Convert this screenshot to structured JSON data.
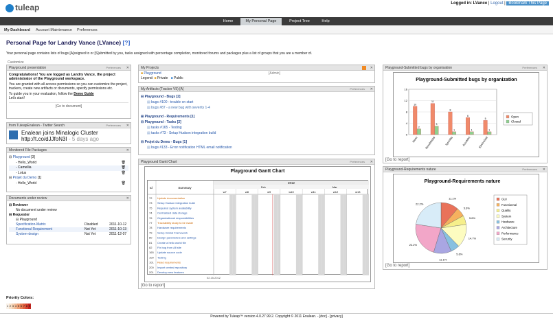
{
  "app": {
    "logo_text": "tuleap"
  },
  "user": {
    "logged_in": "Logged in: LVance",
    "logout": "Logout",
    "bookmark": "Bookmark This Page"
  },
  "nav": [
    {
      "label": "Home"
    },
    {
      "label": "My Personal Page"
    },
    {
      "label": "Project Tree"
    },
    {
      "label": "Help"
    }
  ],
  "subnav": [
    {
      "label": "My Dashboard"
    },
    {
      "label": "Account Maintenance"
    },
    {
      "label": "Preferences"
    }
  ],
  "page": {
    "title": "Personal Page for Landry Vance (LVance)",
    "help": "[?]",
    "intro": "Your personal page contains lists of bugs [A]ssigned to or [S]ubmitted by you, tasks assigned with percentage completion, monitored forums and packages plus a list of groups that you are a member of.",
    "customize": "Customize"
  },
  "w_presentation": {
    "title": "Playground presentation",
    "p1": "Congratulations! You are logged as Landry Vance, the project administrator of the Playground workspace.",
    "p2": "You are granted with all access permissions so you can customize the project, trackers, create new artifacts or documents, specify permissions etc.",
    "p3a": "To guide you in your evaluation, follow the",
    "p3b": "Demo Guide",
    "p4": "Let's start!",
    "go": "[Go to document]"
  },
  "w_twitter": {
    "title": "from TuleapEnalean - Twitter Search",
    "tweet": "Enalean joins Minalogic Cluster",
    "link": "http://t.co/dJJfoN3I",
    "time": "- 5 days ago"
  },
  "w_packages": {
    "title": "Monitored File Packages",
    "g1": "Playground",
    "g1n": "[3]",
    "items1": [
      "- Hello_World",
      "- Camellia",
      "- Lotus"
    ],
    "g2": "Projet du Demo",
    "g2n": "[1]",
    "items2": [
      "- Hello_World"
    ]
  },
  "w_docs": {
    "title": "Documents under review",
    "reviewer": "Reviewer",
    "no_doc": "No document under review",
    "requester": "Requester",
    "group": "Playground",
    "rows": [
      {
        "name": "Specification-Matrix",
        "status": "Disabled",
        "date": "2011-10-12"
      },
      {
        "name": "Functional Requirement",
        "status": "Not Yet",
        "date": "2011-10-13"
      },
      {
        "name": "System-design",
        "status": "Not Yet",
        "date": "2011-12-07"
      }
    ]
  },
  "w_projects": {
    "title": "My Projects",
    "project": "Playground",
    "role": "[Admin]",
    "legend": "Legend:",
    "private": "Private",
    "public": "Public"
  },
  "w_artifacts": {
    "title": "My Artifacts (Tracker V5) [A]",
    "g1": "Playground - Bugs [2]",
    "g1items": [
      "bugs #100 - trouble on start",
      "bugs #87 - a new bug with severity 1-4"
    ],
    "g2": "Playground - Requirements [1]",
    "g3": "Playground - Tasks [2]",
    "g3items": [
      "tasks #165 - Testing",
      "tasks #73 - Setup Hudson integration build"
    ],
    "g4": "Projet du Demo - Bugs [1]",
    "g4items": [
      "bugs #133 - Error notification HTML email notification"
    ]
  },
  "w_gantt": {
    "title": "Playground Gantt Chart",
    "chart_title": "Playground Gantt Chart",
    "col_id": "Id",
    "col_summary": "Summary",
    "year": "2012",
    "months": [
      "Feb",
      "Mar"
    ],
    "weeks": [
      "w7",
      "w8",
      "w9",
      "w10",
      "w11",
      "w12",
      "w13"
    ],
    "rows": [
      {
        "id": "72",
        "summary": "Update documentation",
        "type": "red"
      },
      {
        "id": "73",
        "summary": "Setup Hudson integration build",
        "type": "blue"
      },
      {
        "id": "75",
        "summary": "Required system availability",
        "type": "blue"
      },
      {
        "id": "74",
        "summary": "Centralized data storage",
        "type": "blue"
      },
      {
        "id": "76",
        "summary": "Organizational responsibilities",
        "type": "blue"
      },
      {
        "id": "77",
        "summary": "Traceability study to be made",
        "type": "red"
      },
      {
        "id": "78",
        "summary": "Hardware requirements",
        "type": "blue"
      },
      {
        "id": "79",
        "summary": "Setup Global Framework",
        "type": "blue"
      },
      {
        "id": "80",
        "summary": "Design parameters and settings",
        "type": "blue"
      },
      {
        "id": "81",
        "summary": "Create a hello world file",
        "type": "blue"
      },
      {
        "id": "82",
        "summary": "Fix bug from All site",
        "type": "blue"
      },
      {
        "id": "165",
        "summary": "Update source code",
        "type": "blue"
      },
      {
        "id": "100",
        "summary": "Testing",
        "type": "blue"
      },
      {
        "id": "101",
        "summary": "Read requirements",
        "type": "red"
      },
      {
        "id": "200",
        "summary": "Import central repository",
        "type": "blue"
      },
      {
        "id": "201",
        "summary": "Develop new features",
        "type": "blue"
      }
    ],
    "date": "02.15.2012",
    "go": "[Go to report]"
  },
  "w_bugs_org": {
    "title": "Playground-Submitted bugs by organisation",
    "go": "[Go to report]"
  },
  "w_req_nature": {
    "title": "Playground-Requirements nature",
    "go": "[Go to report]"
  },
  "chart_data": [
    {
      "type": "bar",
      "title": "Playground-Submitted bugs by organization",
      "categories": [
        "None",
        "ResoMedial",
        "Syncidia",
        "AccuMixt",
        "ElectroSoft"
      ],
      "series": [
        {
          "name": "Open",
          "values": [
            10,
            11,
            8,
            6,
            5
          ]
        },
        {
          "name": "Closed",
          "values": [
            2,
            3,
            1,
            1,
            1
          ]
        }
      ],
      "ylim": [
        0,
        16
      ],
      "colors": {
        "Open": "#f08a6a",
        "Closed": "#8fd08f"
      },
      "legend": "right"
    },
    {
      "type": "pie",
      "title": "Playground-Requirements nature",
      "labels": [
        "GUI",
        "Functionnal",
        "Quality",
        "System",
        "Hardware",
        "Architecture",
        "Performance",
        "Security"
      ],
      "values": [
        11.1,
        5.6,
        5.6,
        14.7,
        5.6,
        11.1,
        22.2,
        22.2
      ],
      "label_text": [
        "11.1%",
        "5.6%",
        "5.6%",
        "14.7%",
        "5.6%",
        "11.1%",
        "22.2%",
        "22.2%"
      ],
      "colors": [
        "#e9725a",
        "#f6b15e",
        "#f6ef8a",
        "#fdfcc0",
        "#88c0e0",
        "#a9a6e2",
        "#f2a6c8",
        "#d8ecf8"
      ],
      "legend": "right"
    }
  ],
  "priority": {
    "label": "Priority Colors:",
    "values": [
      "1",
      "2",
      "3",
      "4",
      "5",
      "6",
      "7",
      "8",
      "9"
    ],
    "colors": [
      "#f8f0e8",
      "#f6e2cc",
      "#f3cfb0",
      "#f0b792",
      "#ec9d74",
      "#e77f55",
      "#e06140",
      "#d6402e",
      "#c0251e"
    ]
  },
  "footer": {
    "text": "Powered by Tuleap™ version 4.0.27.99.2. Copyright © 2011 Enalean. - [doc] - [privacy]"
  }
}
